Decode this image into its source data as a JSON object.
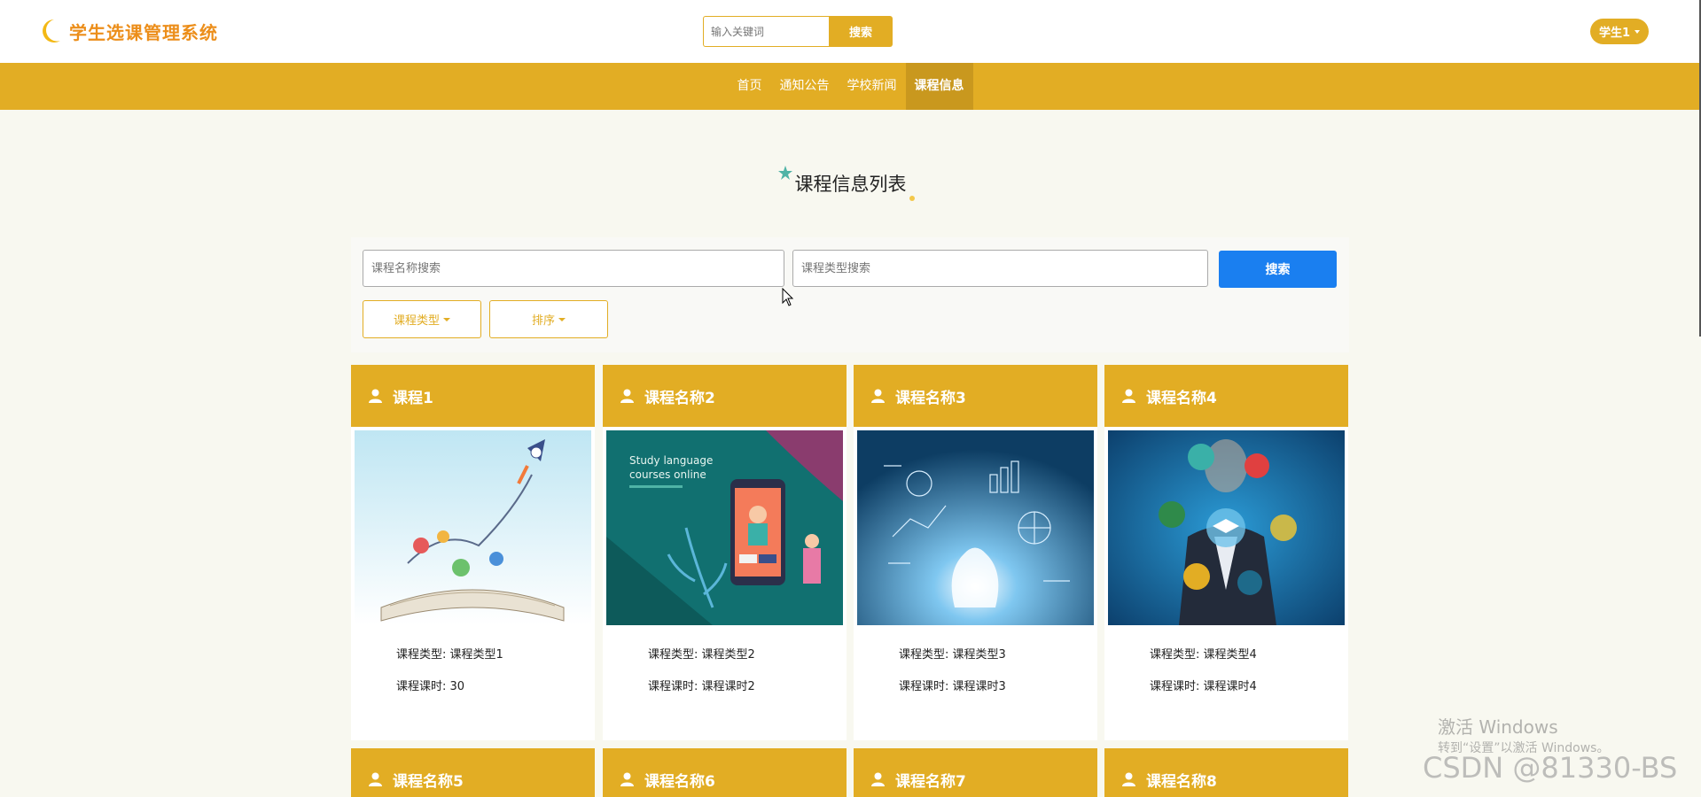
{
  "header": {
    "app_title": "学生选课管理系统",
    "search_placeholder": "输入关键词",
    "search_button": "搜索",
    "user_label": "学生1"
  },
  "nav": {
    "items": [
      {
        "label": "首页",
        "active": false
      },
      {
        "label": "通知公告",
        "active": false
      },
      {
        "label": "学校新闻",
        "active": false
      },
      {
        "label": "课程信息",
        "active": true
      }
    ]
  },
  "page": {
    "title": "课程信息列表"
  },
  "filters": {
    "name_placeholder": "课程名称搜索",
    "type_placeholder": "课程类型搜索",
    "search_button": "搜索",
    "type_dropdown": "课程类型",
    "sort_dropdown": "排序"
  },
  "courses": [
    {
      "name": "课程1",
      "type_label": "课程类型: 课程类型1",
      "hours_label": "课程课时: 30",
      "image": "book-rocket-win"
    },
    {
      "name": "课程名称2",
      "type_label": "课程类型: 课程类型2",
      "hours_label": "课程课时: 课程课时2",
      "image": "study-language-online",
      "image_text_1": "Study language",
      "image_text_2": "courses online"
    },
    {
      "name": "课程名称3",
      "type_label": "课程类型: 课程类型3",
      "hours_label": "课程课时: 课程课时3",
      "image": "lightbulb-sketch"
    },
    {
      "name": "课程名称4",
      "type_label": "课程类型: 课程类型4",
      "hours_label": "课程课时: 课程课时4",
      "image": "businessman-education-icons"
    },
    {
      "name": "课程名称5"
    },
    {
      "name": "课程名称6"
    },
    {
      "name": "课程名称7"
    },
    {
      "name": "课程名称8"
    }
  ],
  "watermark": {
    "line1": "激活 Windows",
    "line2": "转到“设置”以激活 Windows。",
    "csdn": "CSDN @81330-BS"
  },
  "colors": {
    "accent": "#e2ad24",
    "logo_text": "#ec8e1a",
    "primary_button": "#1a7ff0",
    "page_background": "#f8f8f0"
  }
}
